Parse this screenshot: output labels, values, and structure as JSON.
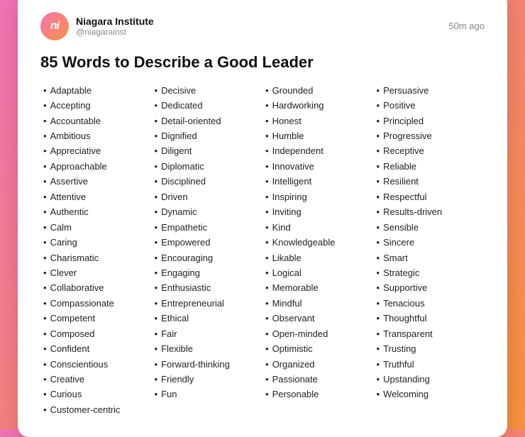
{
  "header": {
    "logo_text": "ni",
    "org_name": "Niagara Institute",
    "org_handle": "@niagarainst",
    "timestamp": "50m ago"
  },
  "title": "85 Words to Describe a Good Leader",
  "columns": [
    {
      "id": "col1",
      "items": [
        "Adaptable",
        "Accepting",
        "Accountable",
        "Ambitious",
        "Appreciative",
        "Approachable",
        "Assertive",
        "Attentive",
        "Authentic",
        "Calm",
        "Caring",
        "Charismatic",
        "Clever",
        "Collaborative",
        "Compassionate",
        "Competent",
        "Composed",
        "Confident",
        "Conscientious",
        "Creative",
        "Curious",
        "Customer-centric"
      ]
    },
    {
      "id": "col2",
      "items": [
        "Decisive",
        "Dedicated",
        "Detail-oriented",
        "Dignified",
        "Diligent",
        "Diplomatic",
        "Disciplined",
        "Driven",
        "Dynamic",
        "Empathetic",
        "Empowered",
        "Encouraging",
        "Engaging",
        "Enthusiastic",
        "Entrepreneurial",
        "Ethical",
        "Fair",
        "Flexible",
        "Forward-thinking",
        "Friendly",
        "Fun"
      ]
    },
    {
      "id": "col3",
      "items": [
        "Grounded",
        "Hardworking",
        "Honest",
        "Humble",
        "Independent",
        "Innovative",
        "Intelligent",
        "Inspiring",
        "Inviting",
        "Kind",
        "Knowledgeable",
        "Likable",
        "Logical",
        "Memorable",
        "Mindful",
        "Observant",
        "Open-minded",
        "Optimistic",
        "Organized",
        "Passionate",
        "Personable"
      ]
    },
    {
      "id": "col4",
      "items": [
        "Persuasive",
        "Positive",
        "Principled",
        "Progressive",
        "Receptive",
        "Reliable",
        "Resilient",
        "Respectful",
        "Results-driven",
        "Sensible",
        "Sincere",
        "Smart",
        "Strategic",
        "Supportive",
        "Tenacious",
        "Thoughtful",
        "Transparent",
        "Trusting",
        "Truthful",
        "Upstanding",
        "Welcoming"
      ]
    }
  ]
}
